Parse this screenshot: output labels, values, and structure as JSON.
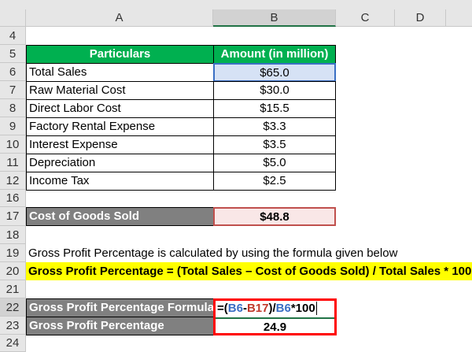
{
  "columns": [
    "A",
    "B",
    "C",
    "D"
  ],
  "rows": [
    "4",
    "5",
    "6",
    "7",
    "8",
    "9",
    "10",
    "11",
    "12",
    "16",
    "17",
    "18",
    "19",
    "20",
    "21",
    "22",
    "23",
    "24"
  ],
  "table": {
    "header": [
      "Particulars",
      "Amount (in million)"
    ],
    "items": [
      [
        "Total Sales",
        "$65.0"
      ],
      [
        "Raw Material Cost",
        "$30.0"
      ],
      [
        "Direct Labor Cost",
        "$15.5"
      ],
      [
        "Factory Rental Expense",
        "$3.3"
      ],
      [
        "Interest Expense",
        "$3.5"
      ],
      [
        "Depreciation",
        "$5.0"
      ],
      [
        "Income Tax",
        "$2.5"
      ]
    ]
  },
  "cogs": {
    "label": "Cost of Goods Sold",
    "value": "$48.8"
  },
  "note": "Gross Profit Percentage is calculated by using the formula given below",
  "formula_text": "Gross Profit Percentage = (Total Sales – Cost of Goods Sold) / Total Sales * 100",
  "gpp_formula": {
    "label": "Gross Profit Percentage Formula",
    "parts": [
      "=(",
      "B6",
      "-",
      "B17",
      ")/",
      "B6",
      "*100"
    ]
  },
  "gpp": {
    "label": "Gross Profit Percentage",
    "value": "24.9"
  },
  "colors": {
    "header_green": "#00b050",
    "highlight_yellow": "#ffff00",
    "ref_blue": "#3a6fc4",
    "ref_red": "#c0392b",
    "outline_red": "#ff0000"
  }
}
